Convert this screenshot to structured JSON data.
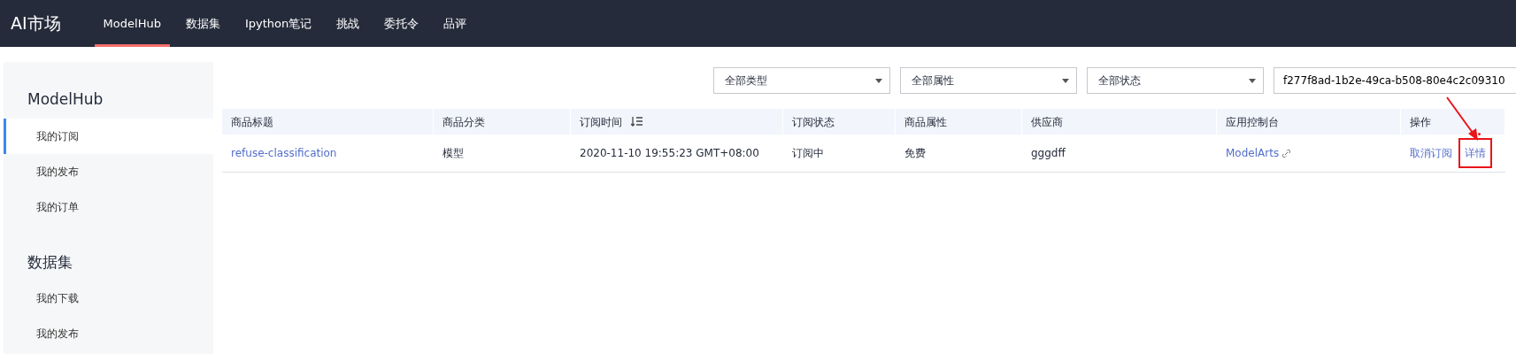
{
  "brand": "AI市场",
  "nav": [
    {
      "label": "ModelHub",
      "selected": true
    },
    {
      "label": "数据集",
      "selected": false
    },
    {
      "label": "Ipython笔记",
      "selected": false
    },
    {
      "label": "挑战",
      "selected": false
    },
    {
      "label": "委托令",
      "selected": false
    },
    {
      "label": "品评",
      "selected": false
    }
  ],
  "sidebar": {
    "sections": [
      {
        "title": "ModelHub",
        "items": [
          {
            "label": "我的订阅",
            "selected": true
          },
          {
            "label": "我的发布",
            "selected": false
          },
          {
            "label": "我的订单",
            "selected": false
          }
        ]
      },
      {
        "title": "数据集",
        "items": [
          {
            "label": "我的下载",
            "selected": false
          },
          {
            "label": "我的发布",
            "selected": false
          }
        ]
      }
    ]
  },
  "filters": [
    {
      "value": "全部类型"
    },
    {
      "value": "全部属性"
    },
    {
      "value": "全部状态"
    }
  ],
  "search": {
    "value": "f277f8ad-1b2e-49ca-b508-80e4c2c09310"
  },
  "table": {
    "columns": [
      {
        "label": "商品标题",
        "sortable": false
      },
      {
        "label": "商品分类",
        "sortable": false
      },
      {
        "label": "订阅时间",
        "sortable": true
      },
      {
        "label": "订阅状态",
        "sortable": false
      },
      {
        "label": "商品属性",
        "sortable": false
      },
      {
        "label": "供应商",
        "sortable": false
      },
      {
        "label": "应用控制台",
        "sortable": false
      },
      {
        "label": "操作",
        "sortable": false
      }
    ],
    "rows": [
      {
        "title": "refuse-classification",
        "category": "模型",
        "time": "2020-11-10 19:55:23 GMT+08:00",
        "status": "订阅中",
        "attribute": "免费",
        "vendor": "gggdff",
        "console": "ModelArts",
        "actions": [
          {
            "label": "取消订阅",
            "highlighted": false
          },
          {
            "label": "详情",
            "highlighted": true
          }
        ]
      }
    ]
  }
}
